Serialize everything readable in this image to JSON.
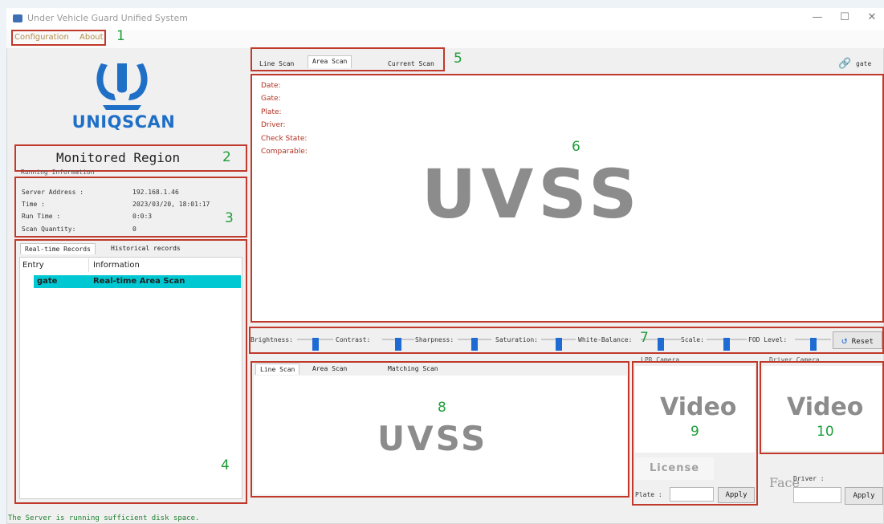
{
  "window": {
    "title": "Under Vehicle Guard Unified System",
    "minimize": "—",
    "maximize": "☐",
    "close": "✕"
  },
  "menu": {
    "items": [
      "Configuration",
      "About"
    ]
  },
  "logo": {
    "text": "UNIQSCAN"
  },
  "region": {
    "title": "Monitored Region"
  },
  "running_info": {
    "title": "Running Information",
    "rows": [
      {
        "label": "Server Address :",
        "value": "192.168.1.46"
      },
      {
        "label": "Time :",
        "value": "2023/03/20, 18:01:17"
      },
      {
        "label": "Run Time :",
        "value": "0:0:3"
      },
      {
        "label": "Scan Quantity:",
        "value": "0"
      }
    ]
  },
  "records": {
    "tabs": [
      "Real-time Records",
      "Historical records"
    ],
    "columns": [
      "Entry",
      "Information"
    ],
    "rows": [
      {
        "entry": "gate",
        "info": "Real-time Area Scan"
      }
    ]
  },
  "scan_tabs": {
    "items": [
      "Line Scan",
      "Area Scan",
      "Current Scan"
    ],
    "gate_label": "gate"
  },
  "info_fields": [
    "Date:",
    "Gate:",
    "Plate:",
    "Driver:",
    "Check State:",
    "Comparable:"
  ],
  "main_image": {
    "text": "UVSS"
  },
  "sliders": {
    "items": [
      {
        "label": "Brightness:",
        "level": 0.5
      },
      {
        "label": "Contrast:",
        "level": 0.5
      },
      {
        "label": "Sharpness:",
        "level": 0.5
      },
      {
        "label": "Saturation:",
        "level": 0.5
      },
      {
        "label": "White-Balance:",
        "level": 0.5
      },
      {
        "label": "Scale:",
        "level": 0.5
      },
      {
        "label": "FOD Level:",
        "level": 0.5
      }
    ],
    "reset_label": "Reset"
  },
  "bottom_tabs": {
    "items": [
      "Line Scan",
      "Area Scan",
      "Matching Scan"
    ]
  },
  "bottom_image": {
    "text": "UVSS"
  },
  "lpr": {
    "title": "LPR Camera",
    "video": "Video",
    "license": "License",
    "plate_label": "Plate :",
    "apply": "Apply"
  },
  "driver": {
    "title": "Driver Camera",
    "video": "Video",
    "face": "Face",
    "driver_label": "Driver :",
    "apply": "Apply"
  },
  "status": {
    "text": "The Server is running sufficient disk space."
  },
  "annotations": [
    "1",
    "2",
    "3",
    "4",
    "5",
    "6",
    "7",
    "8",
    "9",
    "10"
  ],
  "colors": {
    "annotation_box": "#c0392b",
    "annotation_number": "#1e9e3a",
    "highlight_row": "#00c8d2",
    "slider_thumb": "#1f6bd4",
    "field_label": "#b03020"
  }
}
